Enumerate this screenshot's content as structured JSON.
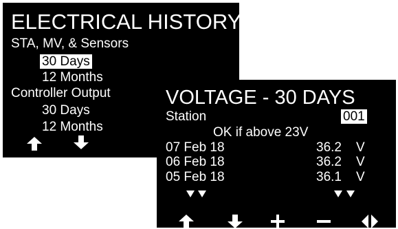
{
  "history_screen": {
    "title": "ELECTRICAL HISTORY",
    "section1": "STA, MV, & Sensors",
    "s1_opt1": "30 Days",
    "s1_opt2": "12 Months",
    "section2": "Controller Output",
    "s2_opt1": "30 Days",
    "s2_opt2": "12 Months",
    "buttons": [
      "arrow-up",
      "arrow-down"
    ]
  },
  "voltage_screen": {
    "title": "VOLTAGE - 30 DAYS",
    "station_label": "Station",
    "station_value": "001",
    "ok_text": "OK if above 23V",
    "rows": [
      {
        "date": "07 Feb 18",
        "value": "36.2",
        "unit": "V"
      },
      {
        "date": "06 Feb 18",
        "value": "36.2",
        "unit": "V"
      },
      {
        "date": "05 Feb 18",
        "value": "36.1",
        "unit": "V"
      }
    ],
    "buttons": [
      "arrow-up",
      "arrow-down",
      "plus",
      "minus",
      "left-right"
    ]
  },
  "colors": {
    "screen_bg": "#000000",
    "text": "#ffffff",
    "page_bg": "#ffffff"
  }
}
